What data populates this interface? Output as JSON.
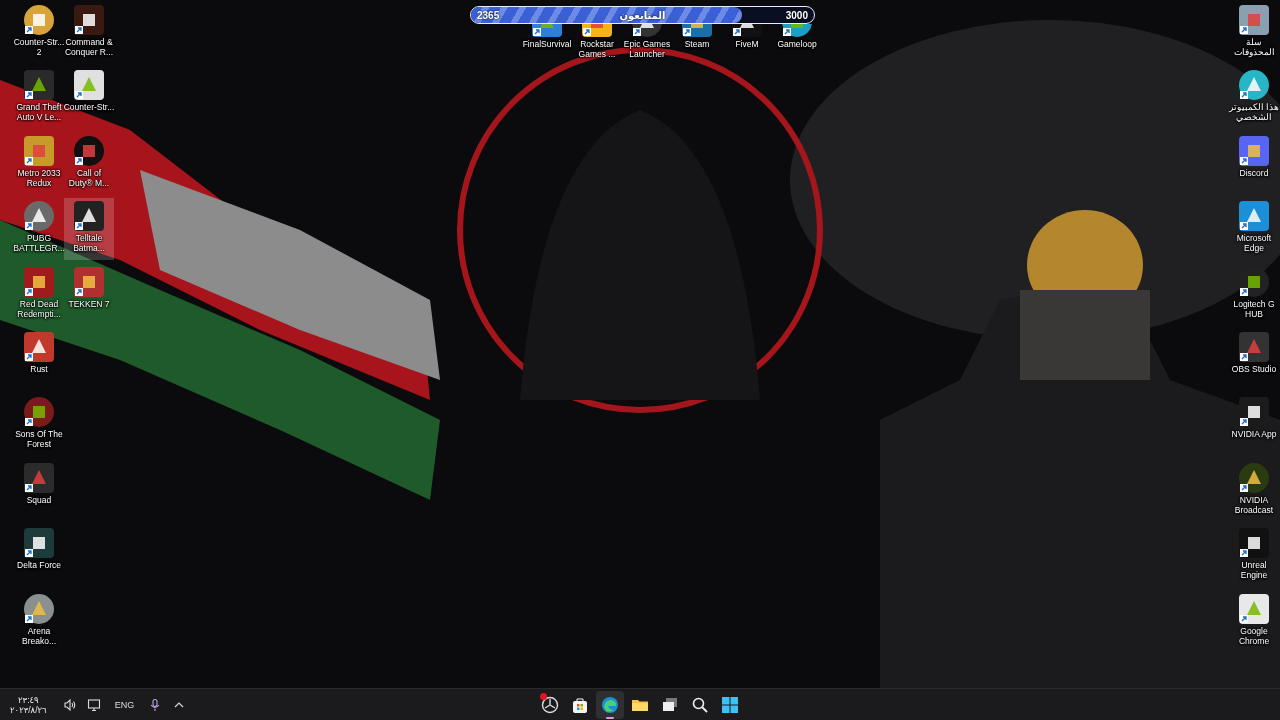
{
  "desktop": {
    "left_icons": [
      {
        "label": "Counter-Str...\n2",
        "hovered": false
      },
      {
        "label": "Grand Theft\nAuto V Le...",
        "hovered": false
      },
      {
        "label": "Metro 2033\nRedux",
        "hovered": false
      },
      {
        "label": "PUBG\nBATTLEGR...",
        "hovered": false
      },
      {
        "label": "Red Dead\nRedempti...",
        "hovered": false
      },
      {
        "label": "Rust",
        "hovered": false
      },
      {
        "label": "Sons Of The\nForest",
        "hovered": false
      },
      {
        "label": "Squad",
        "hovered": false
      },
      {
        "label": "Delta Force",
        "hovered": false
      },
      {
        "label": "Arena\nBreako...",
        "hovered": false
      },
      {
        "label": "Command &\nConquer R...",
        "hovered": false
      },
      {
        "label": "Counter-Str...",
        "hovered": false
      },
      {
        "label": "Call of\nDuty® M...",
        "hovered": false
      },
      {
        "label": "Telltale\nBatma...",
        "hovered": true
      },
      {
        "label": "TEKKEN 7",
        "hovered": false
      }
    ],
    "top_icons": [
      {
        "label": "FinalSurvival"
      },
      {
        "label": "Rockstar\nGames ..."
      },
      {
        "label": "Epic Games\nLauncher"
      },
      {
        "label": "Steam"
      },
      {
        "label": "FiveM"
      },
      {
        "label": "Gameloop"
      }
    ],
    "right_icons": [
      {
        "label": "سلة\nالمحذوفات"
      },
      {
        "label": "هذا الكمبيوتر\nالشخصي"
      },
      {
        "label": "Discord"
      },
      {
        "label": "Microsoft\nEdge"
      },
      {
        "label": "Logitech G\nHUB"
      },
      {
        "label": "OBS Studio"
      },
      {
        "label": "NVIDIA App"
      },
      {
        "label": "NVIDIA\nBroadcast"
      },
      {
        "label": "Unreal\nEngine"
      },
      {
        "label": "Google\nChrome"
      }
    ]
  },
  "follower_bar": {
    "start": "2365",
    "label": "المتابعون",
    "end": "3000",
    "level": 0.79
  },
  "taskbar": {
    "clock": {
      "time": "٢٣:٤٩",
      "date": "٢٠٢٣/٨/٢٦"
    },
    "tray": [
      {
        "kind": "volume"
      },
      {
        "kind": "network"
      },
      {
        "kind": "text",
        "text": "ENG"
      },
      {
        "kind": "mic"
      },
      {
        "kind": "chevron"
      }
    ],
    "apps": [
      {
        "kind": "app",
        "selected": false,
        "notification": true
      },
      {
        "kind": "store",
        "selected": false,
        "notification": false
      },
      {
        "kind": "edge",
        "selected": true,
        "notification": false
      },
      {
        "kind": "explorer",
        "selected": false,
        "notification": false
      },
      {
        "kind": "taskview",
        "selected": false,
        "notification": false
      },
      {
        "kind": "search",
        "selected": false,
        "notification": false
      },
      {
        "kind": "start",
        "selected": false,
        "notification": false
      }
    ]
  }
}
